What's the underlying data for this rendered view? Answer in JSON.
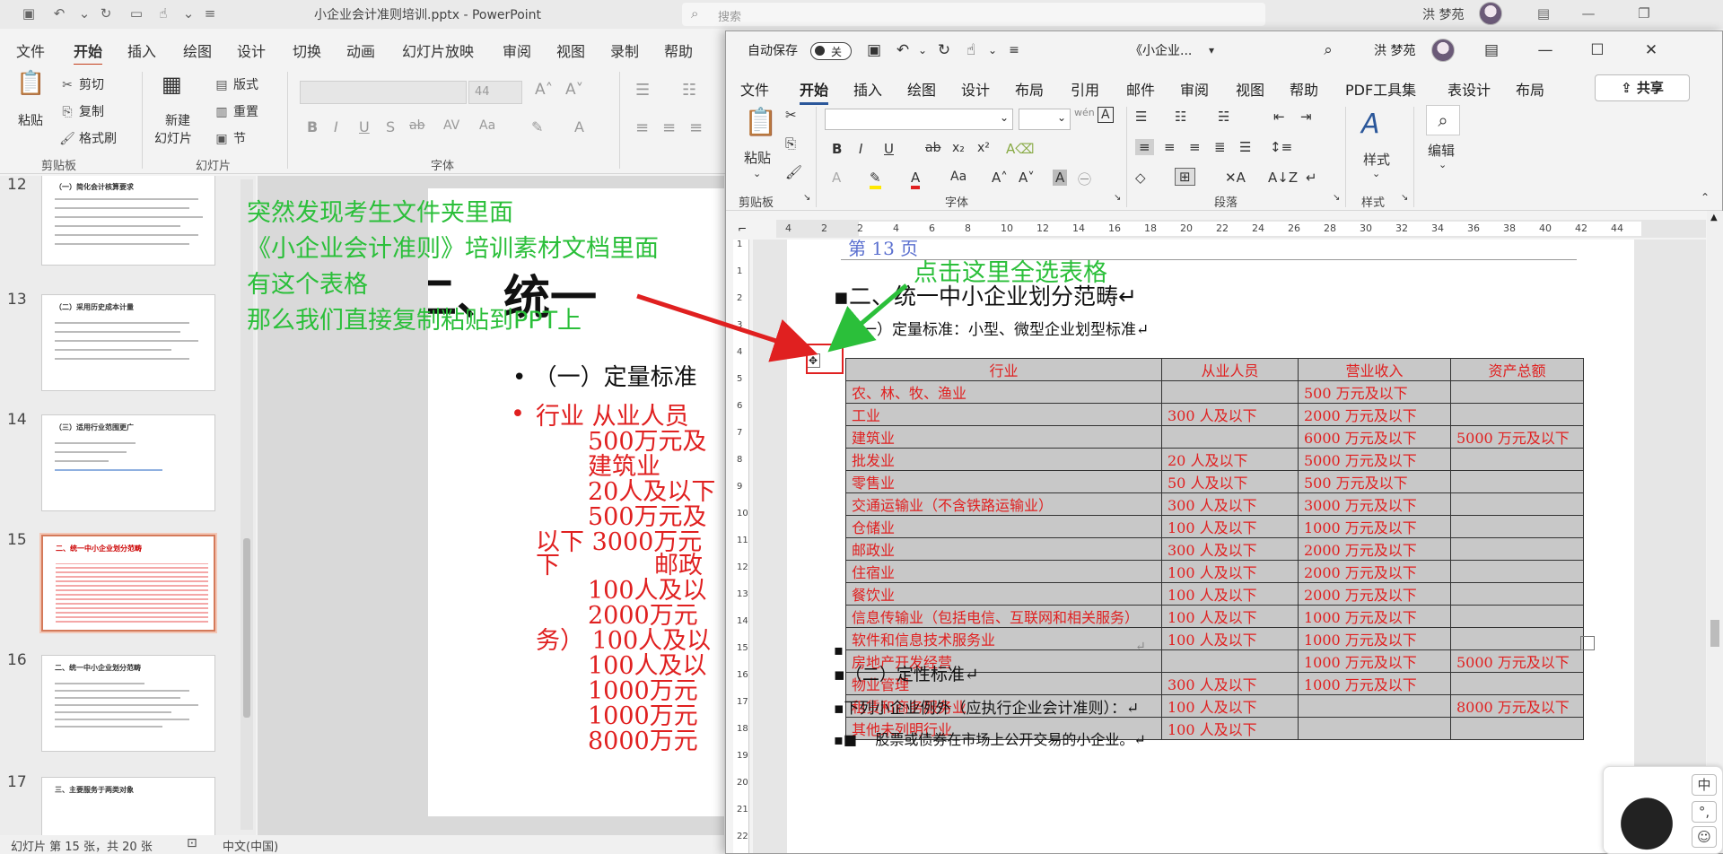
{
  "ppt": {
    "doc_title": "小企业会计准则培训.pptx - PowerPoint",
    "search_placeholder": "搜索",
    "user_name": "洪 梦苑",
    "tabs": [
      "文件",
      "开始",
      "插入",
      "绘图",
      "设计",
      "切换",
      "动画",
      "幻灯片放映",
      "审阅",
      "视图",
      "录制",
      "帮助"
    ],
    "ribbon": {
      "paste": "粘贴",
      "cut": "剪切",
      "copy": "复制",
      "format_painter": "格式刷",
      "clipboard_group": "剪贴板",
      "new_slide": "新建",
      "new_slide_2": "幻灯片",
      "layout": "版式",
      "reset": "重置",
      "section": "节",
      "slides_group": "幻灯片",
      "font_size": "44",
      "font_group": "字体"
    },
    "thumbnails": [
      {
        "num": "12",
        "title": "（一）简化会计核算要求"
      },
      {
        "num": "13",
        "title": "（二）采用历史成本计量"
      },
      {
        "num": "14",
        "title": "（三）适用行业范围更广"
      },
      {
        "num": "15",
        "title": "二、统一中小企业划分范畴"
      },
      {
        "num": "16",
        "title": "二、统一中小企业划分范畴"
      },
      {
        "num": "17",
        "title": "三、主要服务于两类对象"
      }
    ],
    "slide": {
      "title": "二、统一",
      "bullet1": "（一）定量标准",
      "red_lines": [
        "行业 从业人员",
        "500万元及",
        "建筑业",
        "20人及以下",
        "500万元及",
        "以下 3000万元",
        "下",
        "邮政",
        "100人及以",
        "2000万元",
        "务）  100人及以",
        "100人及以",
        "1000万元",
        "1000万元",
        "8000万元"
      ]
    },
    "annotation": [
      "突然发现考生文件夹里面",
      "《小企业会计准则》培训素材文档里面",
      "有这个表格",
      "那么我们直接复制粘贴到PPT上"
    ],
    "status": {
      "slide_info": "幻灯片 第 15 张，共 20 张",
      "language": "中文(中国)"
    }
  },
  "word": {
    "autosave": "自动保存",
    "toggle_off": "关",
    "doc_title": "《小企业...",
    "user_name": "洪 梦苑",
    "tabs": [
      "文件",
      "开始",
      "插入",
      "绘图",
      "设计",
      "布局",
      "引用",
      "邮件",
      "审阅",
      "视图",
      "帮助",
      "PDF工具集",
      "表设计",
      "布局"
    ],
    "share": "共享",
    "ribbon": {
      "paste": "粘贴",
      "clipboard_group": "剪贴板",
      "font_group": "字体",
      "paragraph_group": "段落",
      "styles": "样式",
      "styles_group": "样式",
      "edit": "编辑"
    },
    "ruler_numbers": [
      "4",
      "2",
      "2",
      "4",
      "6",
      "8",
      "10",
      "12",
      "14",
      "16",
      "18",
      "20",
      "22",
      "24",
      "26",
      "28",
      "30",
      "32",
      "34",
      "36",
      "38",
      "40",
      "42",
      "44"
    ],
    "doc": {
      "page_header": "第 13 页",
      "heading": "二、统一中小企业划分范畴",
      "sub1": "（一）定量标准：小型、微型企业划型标准",
      "table_headers": [
        "行业",
        "从业人员",
        "营业收入",
        "资产总额"
      ],
      "table_rows": [
        [
          "农、林、牧、渔业",
          "",
          "500 万元及以下",
          ""
        ],
        [
          "工业",
          "300 人及以下",
          "2000 万元及以下",
          ""
        ],
        [
          "建筑业",
          "",
          "6000 万元及以下",
          "5000 万元及以下"
        ],
        [
          "批发业",
          "20 人及以下",
          "5000 万元及以下",
          ""
        ],
        [
          "零售业",
          "50 人及以下",
          "500 万元及以下",
          ""
        ],
        [
          "交通运输业（不含铁路运输业）",
          "300 人及以下",
          "3000 万元及以下",
          ""
        ],
        [
          "仓储业",
          "100 人及以下",
          "1000 万元及以下",
          ""
        ],
        [
          "邮政业",
          "300 人及以下",
          "2000 万元及以下",
          ""
        ],
        [
          "住宿业",
          "100 人及以下",
          "2000 万元及以下",
          ""
        ],
        [
          "餐饮业",
          "100 人及以下",
          "2000 万元及以下",
          ""
        ],
        [
          "信息传输业（包括电信、互联网和相关服务）",
          "100 人及以下",
          "1000 万元及以下",
          ""
        ],
        [
          "软件和信息技术服务业",
          "100 人及以下",
          "1000 万元及以下",
          ""
        ],
        [
          "房地产开发经营",
          "",
          "1000 万元及以下",
          "5000 万元及以下"
        ],
        [
          "物业管理",
          "300 人及以下",
          "1000 万元及以下",
          ""
        ],
        [
          "租赁和商务服务业",
          "100 人及以下",
          "",
          "8000 万元及以下"
        ],
        [
          "其他未列明行业",
          "100 人及以下",
          "",
          ""
        ]
      ],
      "sub2": "（二）定性标准",
      "exception": "下列小企业例外（应执行企业会计准则）：",
      "bullet": "股票或债券在市场上公开交易的小企业。"
    },
    "annotation_click": "点击这里全选表格"
  },
  "ime": {
    "zhong": "中",
    "key2": "中",
    "key3": "中"
  }
}
